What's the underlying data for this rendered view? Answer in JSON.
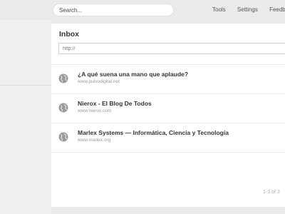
{
  "search": {
    "placeholder": "Search..."
  },
  "nav": {
    "tools": "Tools",
    "settings": "Settings",
    "feedback": "Feedback"
  },
  "inbox": {
    "title": "Inbox",
    "url_placeholder": "http://",
    "feeds": [
      {
        "title": "¿A qué suena una mano que aplaude?",
        "url": "www.pulsodigital.net",
        "icon": "globe-icon"
      },
      {
        "title": "Nierox - El Blog De Todos",
        "url": "www.nierox.com",
        "icon": "globe-icon"
      },
      {
        "title": "Marlex Systems — Informática, Ciencia y Tecnología",
        "url": "www.marlex.org",
        "icon": "globe-icon"
      }
    ],
    "pagination": "1-3 of 3"
  }
}
